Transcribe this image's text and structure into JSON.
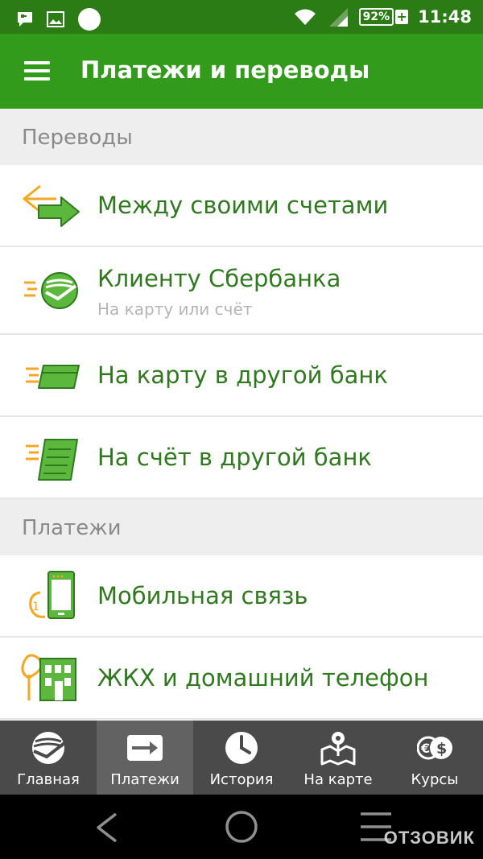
{
  "status_bar": {
    "battery": "92%",
    "battery_charging": "+",
    "time": "11:48",
    "icons": [
      "message-icon",
      "image-icon",
      "circle-icon",
      "wifi-icon",
      "signal-icon",
      "battery-icon"
    ]
  },
  "app_bar": {
    "title": "Платежи и переводы",
    "menu_icon": "hamburger-icon"
  },
  "sections": {
    "transfers": {
      "header": "Переводы",
      "items": [
        {
          "label": "Между своими счетами",
          "icon": "transfer-arrows-icon"
        },
        {
          "label": "Клиенту Сбербанка",
          "sub": "На карту или счёт",
          "icon": "sberbank-logo-icon"
        },
        {
          "label": "На карту в другой банк",
          "icon": "card-icon"
        },
        {
          "label": "На счёт в другой банк",
          "icon": "document-icon"
        }
      ]
    },
    "payments": {
      "header": "Платежи",
      "items": [
        {
          "label": "Мобильная связь",
          "icon": "mobile-phone-icon"
        },
        {
          "label": "ЖКХ и домашний телефон",
          "icon": "house-building-icon"
        }
      ]
    }
  },
  "tabbar": {
    "active": "Платежи",
    "tabs": [
      {
        "label": "Главная",
        "icon": "sberbank-logo-icon"
      },
      {
        "label": "Платежи",
        "icon": "payments-icon"
      },
      {
        "label": "История",
        "icon": "clock-icon"
      },
      {
        "label": "На карте",
        "icon": "map-pin-icon"
      },
      {
        "label": "Курсы",
        "icon": "currency-icon"
      }
    ]
  },
  "navbar": {
    "icons": [
      "back-icon",
      "home-icon",
      "recents-icon"
    ]
  },
  "watermark": "ОТЗОВИК",
  "colors": {
    "status_bar": "#2c7c16",
    "app_bar": "#339b1c",
    "accent_green": "#2f7a1e",
    "accent_orange": "#f5a623",
    "tabbar": "#4a4a4a"
  }
}
